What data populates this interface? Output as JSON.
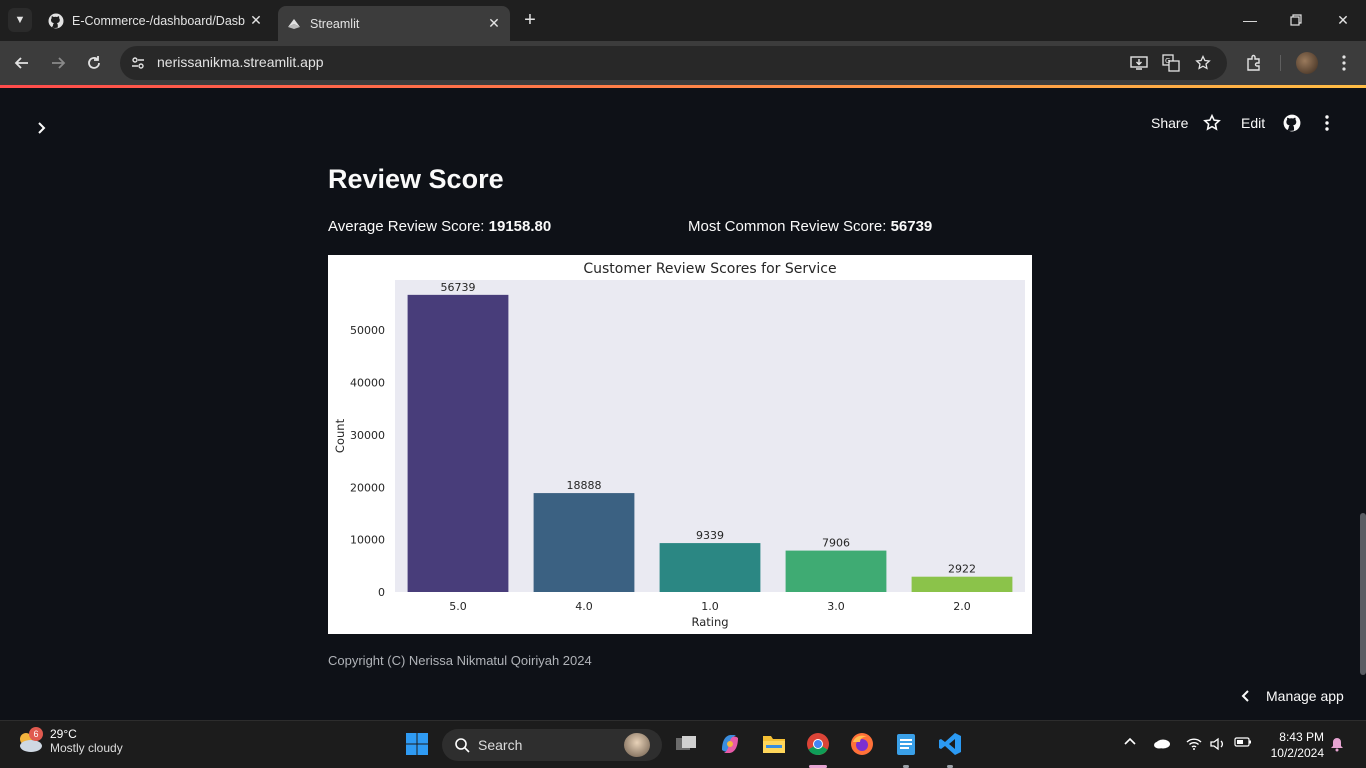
{
  "browser": {
    "tabs": [
      {
        "title": "E-Commerce-/dashboard/Dasb",
        "active": false
      },
      {
        "title": "Streamlit",
        "active": true
      }
    ],
    "url": "nerissanikma.streamlit.app"
  },
  "app_header": {
    "share_label": "Share",
    "edit_label": "Edit"
  },
  "main": {
    "title": "Review Score",
    "avg_label": "Average Review Score: ",
    "avg_value": "19158.80",
    "common_label": "Most Common Review Score: ",
    "common_value": "56739",
    "footer": "Copyright (C) Nerissa Nikmatul Qoiriyah 2024",
    "manage_label": "Manage app"
  },
  "chart_data": {
    "type": "bar",
    "title": "Customer Review Scores for Service",
    "xlabel": "Rating",
    "ylabel": "Count",
    "categories": [
      "5.0",
      "4.0",
      "1.0",
      "3.0",
      "2.0"
    ],
    "values": [
      56739,
      18888,
      9339,
      7906,
      2922
    ],
    "data_labels": [
      "56739",
      "18888",
      "9339",
      "7906",
      "2922"
    ],
    "colors": [
      "#483d7a",
      "#3b6182",
      "#2b8783",
      "#3fab73",
      "#8bc34a"
    ],
    "yticks": [
      "0",
      "10000",
      "20000",
      "30000",
      "40000",
      "50000"
    ],
    "ylim": [
      0,
      59576
    ],
    "grid": false
  },
  "taskbar": {
    "weather_temp": "29°C",
    "weather_desc": "Mostly cloudy",
    "weather_badge": "6",
    "search_label": "Search",
    "time": "8:43 PM",
    "date": "10/2/2024"
  }
}
